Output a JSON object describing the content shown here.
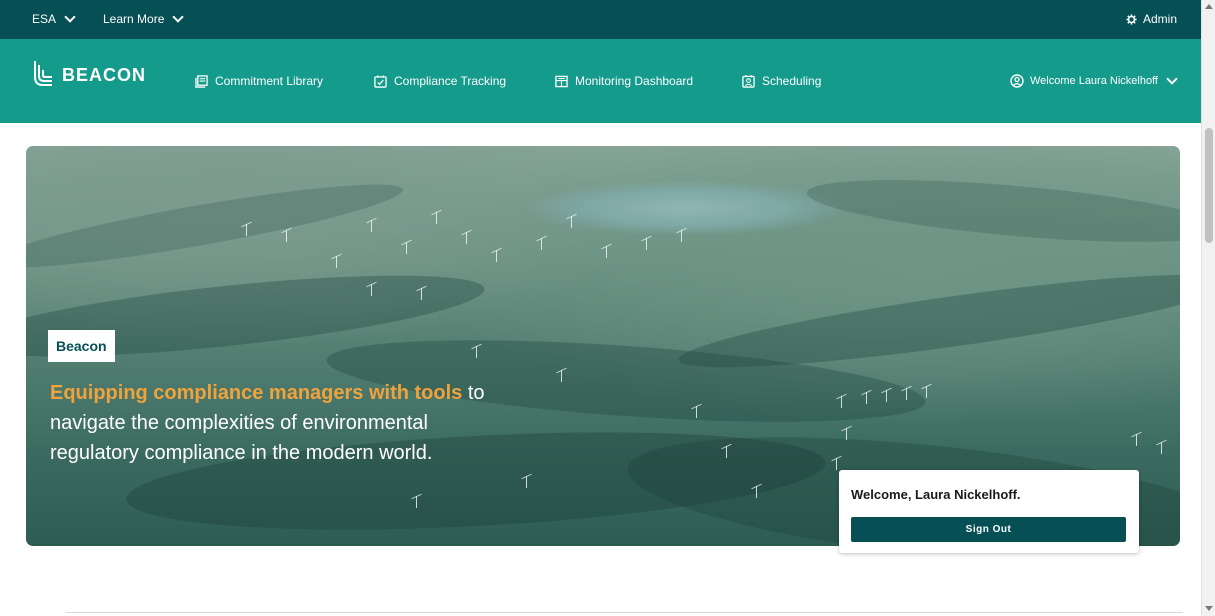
{
  "topbar": {
    "esa_label": "ESA",
    "learn_more_label": "Learn More",
    "admin_label": "Admin"
  },
  "navbar": {
    "logo_text": "BEACON",
    "items": [
      {
        "label": "Commitment Library",
        "icon": "library-icon"
      },
      {
        "label": "Compliance Tracking",
        "icon": "checkbox-icon"
      },
      {
        "label": "Monitoring Dashboard",
        "icon": "dashboard-icon"
      },
      {
        "label": "Scheduling",
        "icon": "scheduling-icon"
      }
    ],
    "welcome_menu_label": "Welcome Laura Nickelhoff"
  },
  "hero": {
    "badge": "Beacon",
    "headline_highlight": "Equipping compliance managers with tools",
    "headline_rest": " to navigate the complexities of environmental regulatory compliance in the modern world."
  },
  "welcome_card": {
    "text": "Welcome, Laura Nickelhoff.",
    "signout_label": "Sign Out"
  },
  "colors": {
    "topbar": "#065055",
    "navbar": "#149b8c",
    "accent": "#f0a23c"
  }
}
